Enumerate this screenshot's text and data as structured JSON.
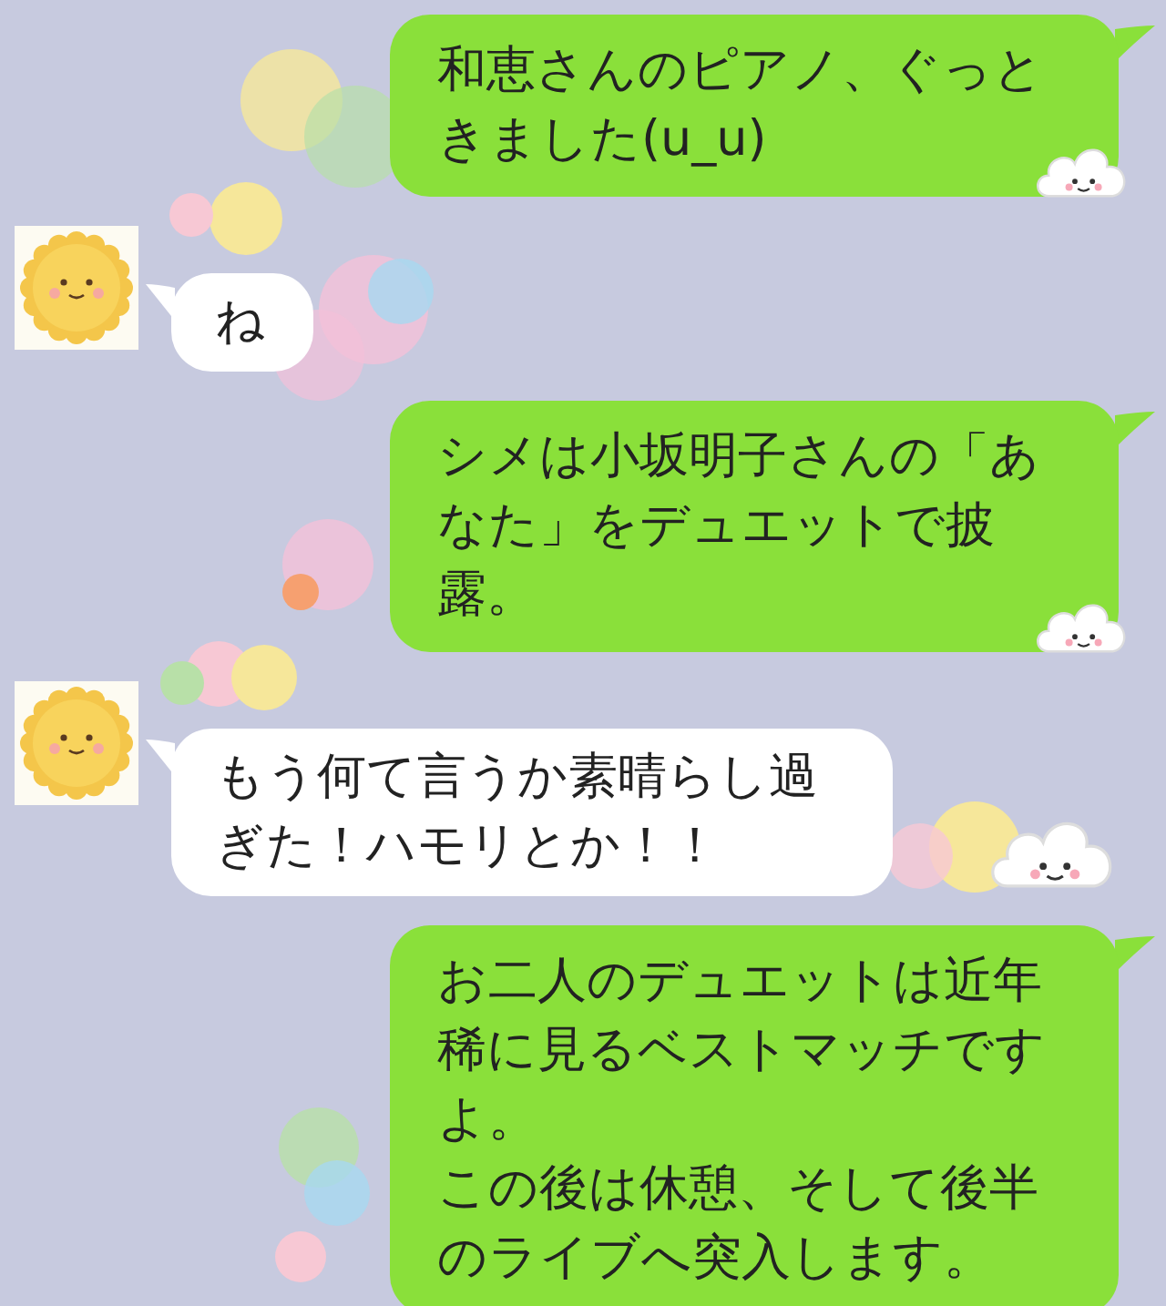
{
  "messages": [
    {
      "kind": "sent",
      "paragraphs": [
        "和恵さんのピアノ、ぐっときました(u_u)"
      ]
    },
    {
      "kind": "received",
      "paragraphs": [
        "ね"
      ]
    },
    {
      "kind": "sent",
      "paragraphs": [
        "シメは小坂明子さんの「あなた」をデュエットで披露。"
      ]
    },
    {
      "kind": "received",
      "paragraphs": [
        "もう何て言うか素晴らし過ぎた！ハモリとか！！"
      ]
    },
    {
      "kind": "sent",
      "paragraphs": [
        "お二人のデュエットは近年稀に見るベストマッチですよ。",
        "この後は休憩、そして後半のライブへ突入します。"
      ]
    }
  ]
}
